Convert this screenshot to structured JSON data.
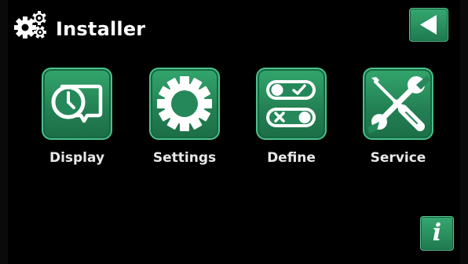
{
  "header": {
    "title": "Installer",
    "icon": "gears-icon"
  },
  "navigation": {
    "back_icon": "back-arrow-icon",
    "info_icon": "info-icon",
    "info_glyph": "i"
  },
  "menu": {
    "items": [
      {
        "label": "Display",
        "icon": "clock-display-icon"
      },
      {
        "label": "Settings",
        "icon": "gear-icon"
      },
      {
        "label": "Define",
        "icon": "toggle-switches-icon"
      },
      {
        "label": "Service",
        "icon": "screwdriver-wrench-icon"
      }
    ]
  },
  "colors": {
    "background": "#000000",
    "accent_green": "#2a8f5d",
    "text": "#ffffff"
  }
}
